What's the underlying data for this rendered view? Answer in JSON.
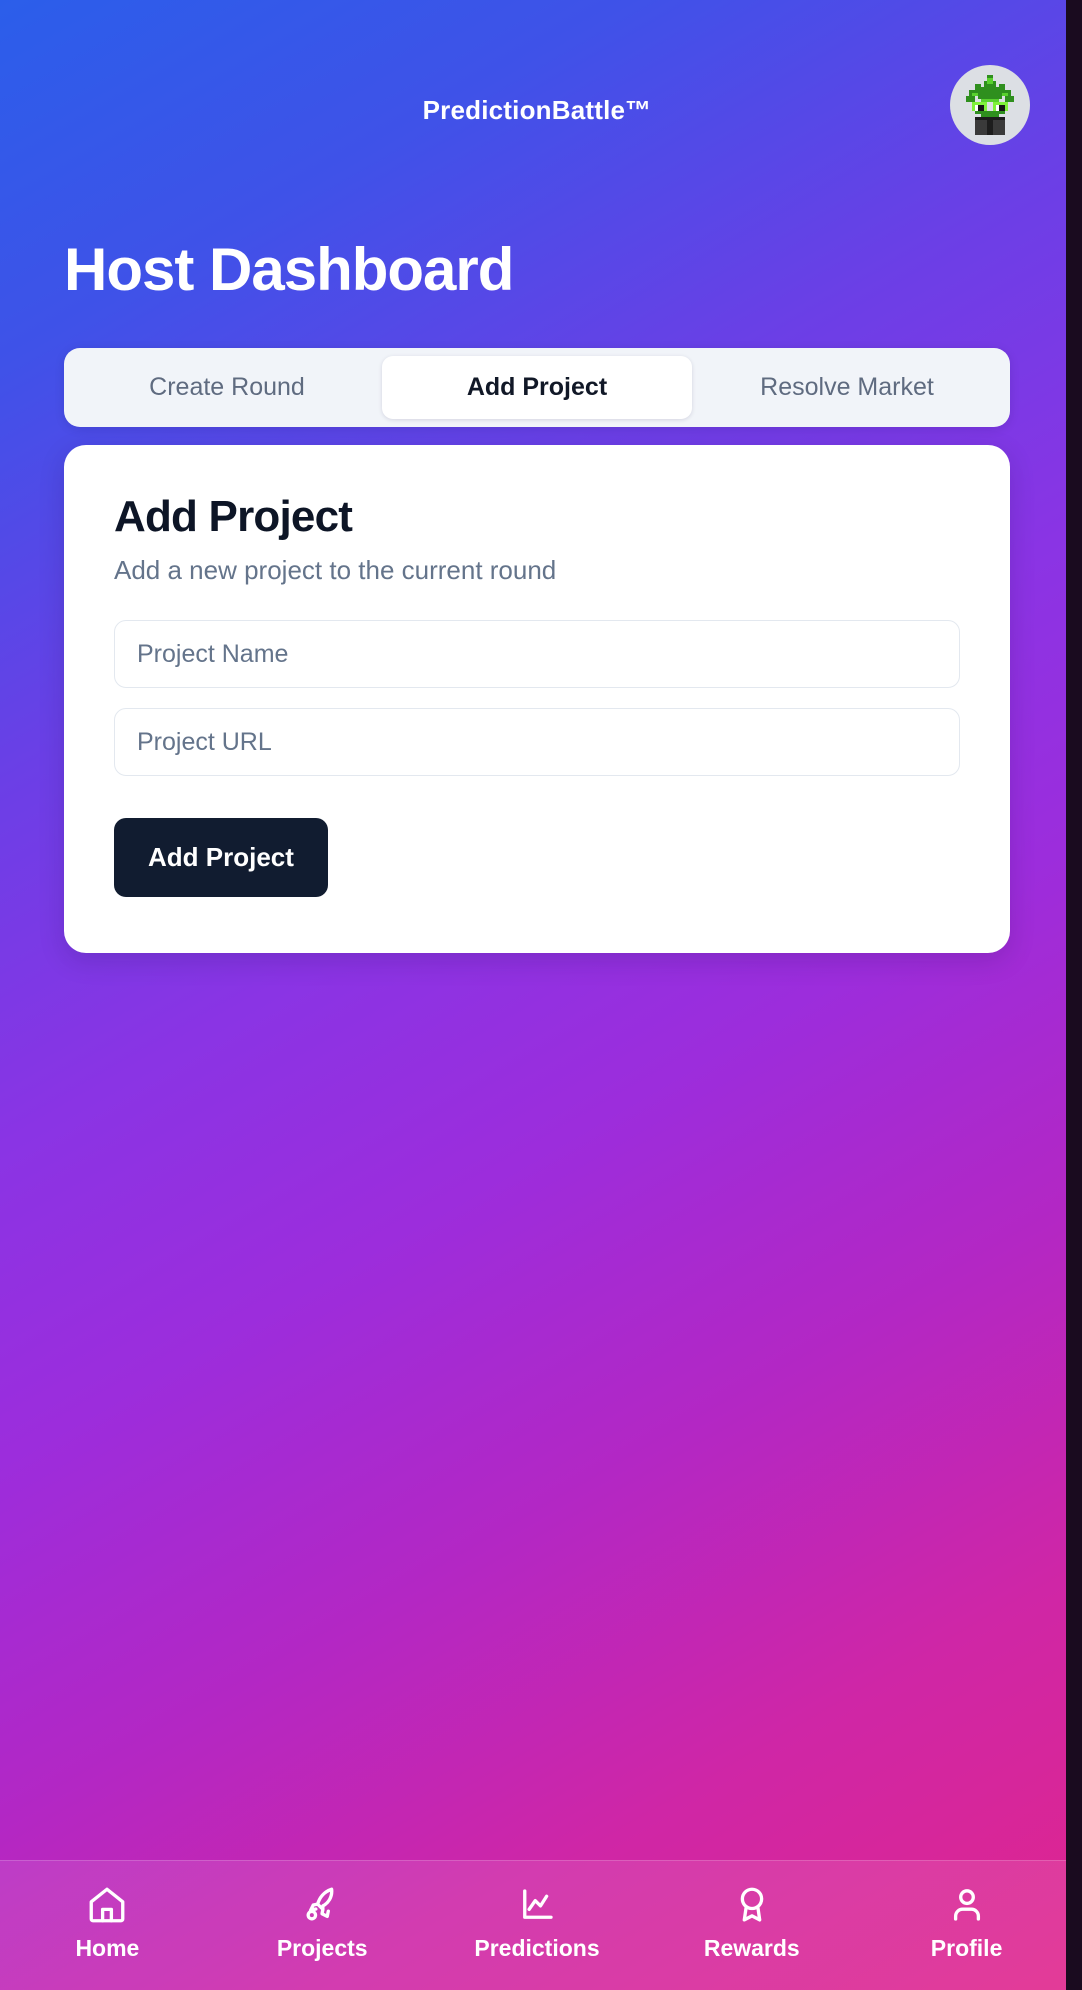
{
  "header": {
    "brand": "PredictionBattle™",
    "avatar_icon": "cannabis-plant-avatar"
  },
  "page": {
    "title": "Host Dashboard"
  },
  "tabs": [
    {
      "label": "Create Round",
      "active": false
    },
    {
      "label": "Add Project",
      "active": true
    },
    {
      "label": "Resolve Market",
      "active": false
    }
  ],
  "card": {
    "title": "Add Project",
    "subtitle": "Add a new project to the current round",
    "fields": [
      {
        "placeholder": "Project Name",
        "value": ""
      },
      {
        "placeholder": "Project URL",
        "value": ""
      }
    ],
    "submit_label": "Add Project"
  },
  "bottom_nav": [
    {
      "label": "Home",
      "icon": "home-icon"
    },
    {
      "label": "Projects",
      "icon": "rocket-icon"
    },
    {
      "label": "Predictions",
      "icon": "line-chart-icon"
    },
    {
      "label": "Rewards",
      "icon": "award-ribbon-icon"
    },
    {
      "label": "Profile",
      "icon": "person-icon"
    }
  ],
  "colors": {
    "gradient_start": "#2b5eea",
    "gradient_mid": "#9c2ddc",
    "gradient_end": "#e0258c",
    "tab_bar_bg": "#f1f4f9",
    "card_bg": "#ffffff",
    "button_bg": "#111c30",
    "muted_text": "#64748b",
    "title_text": "#0d1526"
  }
}
